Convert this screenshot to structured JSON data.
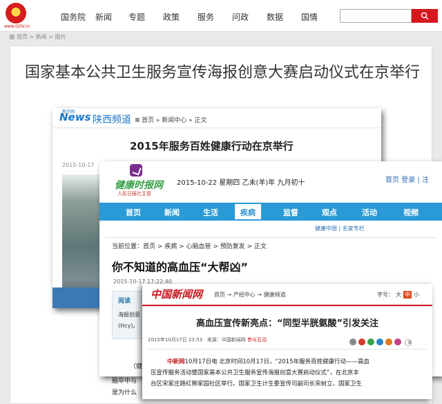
{
  "topnav": {
    "emblem_caption": "www.GOV.cn",
    "items": [
      {
        "label": "国务院"
      },
      {
        "label": "新闻"
      },
      {
        "label": "专题"
      },
      {
        "label": "政策"
      },
      {
        "label": "服务"
      },
      {
        "label": "问政"
      },
      {
        "label": "数据"
      },
      {
        "label": "国情"
      }
    ],
    "search": {
      "value": "",
      "icon": "search-icon"
    }
  },
  "breadcrumb": {
    "text": "首页 > 新闻 > 图片"
  },
  "article": {
    "title": "国家基本公共卫生服务宣传海报创意大赛启动仪式在京举行"
  },
  "shaanxi": {
    "logo_news": "News",
    "logo_sub": "新华网",
    "channel": "陕西频道",
    "crumb": "首页  »  新闻中心  »  正文",
    "title": "2015年服务百姓健康行动在京举行",
    "date": "2015-10-17"
  },
  "healthpaper": {
    "logo_text": "健康时报网",
    "logo_sub": "人民日报社主管",
    "date": "2015-10-22 星期四 乙未(羊)年 九月初十",
    "login": "首页 登录 | 注",
    "nav": [
      "首页",
      "新闻",
      "生活",
      "疾病",
      "监督",
      "观点",
      "活动",
      "视频"
    ],
    "nav_active": "疾病",
    "sublinks": "健康中国  |  名家专栏",
    "crumb": "当前位置：首页 > 疾病 > 心脑血管 > 预防复发 > 正文",
    "title": "你不知道的高血压“大帮凶”",
    "meta": "2015-10-17 17:22:40",
    "box_head": "阅读",
    "box_line1": "海报创意",
    "box_line2": "(Hcy)。",
    "body1": "（健康",
    "body2": "脑卒中与",
    "body3": "是为什么"
  },
  "chinanews": {
    "logo": "中国新闻网",
    "crumb": "首页 → 产经中心 → 健康频道",
    "fontsize_label": "字号：",
    "fontsize_options": [
      "大",
      "中",
      "小"
    ],
    "fontsize_active": "中",
    "title": "高血压宣传新亮点：“同型半胱氨酸”引发关注",
    "meta_date": "2015年10月17日 23:53",
    "meta_source": "来源：中国新闻网",
    "meta_interact": "参与互动",
    "share_count": "0",
    "share_colors": [
      "#8a8a8a",
      "#d33b2a",
      "#3aa14a",
      "#2a86c9",
      "#e37b1e",
      "#c43f8a"
    ],
    "body_source": "中新网",
    "body_line1": "10月17日电  北京时间10月17日，“2015年服务百姓健康行动——高血",
    "body_line2": "压宣传服务活动暨国家基本公共卫生服务宣传海报创意大赛启动仪式”，在北京丰",
    "body_line3": "台区宋家庄路红狮家园社区举行。国家卫生计生委宣传司副司长宋树立、国家卫生"
  }
}
